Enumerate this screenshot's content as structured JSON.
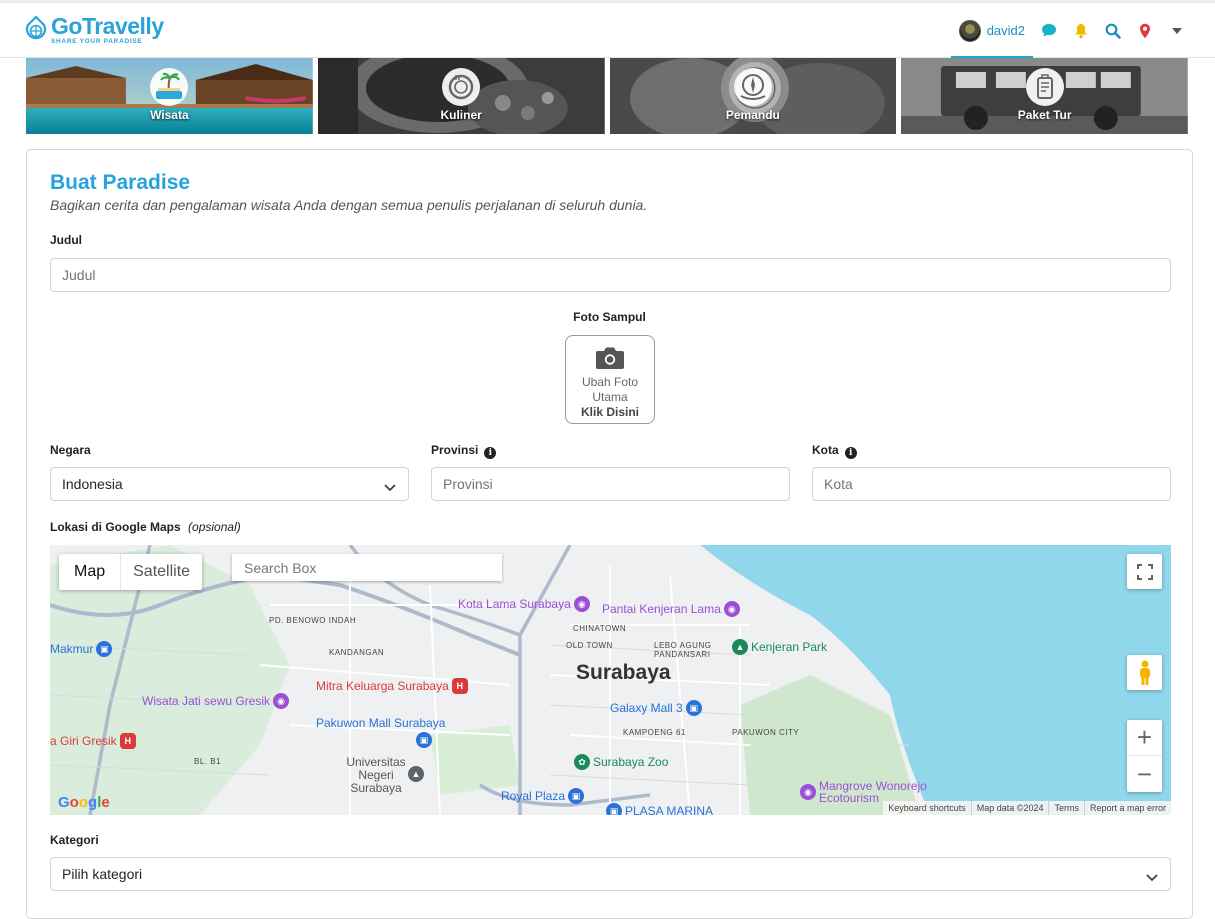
{
  "brand": {
    "name": "GoTravelly",
    "tagline": "SHARE YOUR PARADISE"
  },
  "nav": {
    "username": "david2",
    "icons": [
      "chat-icon",
      "bell-icon",
      "search-icon",
      "location-pin-icon",
      "caret-down-icon"
    ],
    "colors": {
      "chat": "#1bb0c9",
      "bell": "#f5b800",
      "search": "#1a8ec4",
      "pin": "#e0393e"
    }
  },
  "categories": [
    {
      "label": "Wisata",
      "icon": "beach-icon"
    },
    {
      "label": "Kuliner",
      "icon": "food-icon"
    },
    {
      "label": "Pemandu",
      "icon": "guide-icon"
    },
    {
      "label": "Paket Tur",
      "icon": "tour-package-icon"
    }
  ],
  "form": {
    "title": "Buat Paradise",
    "subtitle": "Bagikan cerita dan pengalaman wisata Anda dengan semua penulis perjalanan di seluruh dunia.",
    "judul_label": "Judul",
    "judul_placeholder": "Judul",
    "photo_label": "Foto Sampul",
    "photo_text_1": "Ubah Foto",
    "photo_text_2": "Utama",
    "photo_cta": "Klik Disini",
    "negara_label": "Negara",
    "negara_value": "Indonesia",
    "provinsi_label": "Provinsi",
    "provinsi_placeholder": "Provinsi",
    "kota_label": "Kota",
    "kota_placeholder": "Kota",
    "maps_label": "Lokasi di Google Maps",
    "maps_optional": "(opsional)",
    "kategori_label": "Kategori",
    "kategori_value": "Pilih kategori"
  },
  "map": {
    "type_map": "Map",
    "type_satellite": "Satellite",
    "search_placeholder": "Search Box",
    "city": "Surabaya",
    "logo": "Google",
    "footer": [
      "Keyboard shortcuts",
      "Map data ©2024",
      "Terms",
      "Report a map error"
    ],
    "districts": [
      "PD. BENOWO INDAH",
      "KANDANGAN",
      "CHINATOWN",
      "OLD TOWN",
      "LEBO AGUNG PANDANSARI",
      "KAMPOENG 61",
      "PAKUWON CITY",
      "BL. B1"
    ],
    "pois": [
      {
        "name": "Kota Lama Surabaya",
        "color": "#9c4fd6"
      },
      {
        "name": "Pantai Kenjeran Lama",
        "color": "#9c4fd6"
      },
      {
        "name": "Kenjeran Park",
        "color": "#1a8a5a"
      },
      {
        "name": "Mitra Keluarga Surabaya",
        "color": "#d93b3b"
      },
      {
        "name": "Wisata Jati sewu Gresik",
        "color": "#9c4fd6"
      },
      {
        "name": "Pakuwon Mall Surabaya",
        "color": "#2a72d8"
      },
      {
        "name": "Galaxy Mall 3",
        "color": "#2a72d8"
      },
      {
        "name": "Surabaya Zoo",
        "color": "#1a8a5a"
      },
      {
        "name": "Universitas Negeri Surabaya",
        "color": "#5f6368"
      },
      {
        "name": "Royal Plaza",
        "color": "#2a72d8"
      },
      {
        "name": "PLASA MARINA",
        "color": "#2a72d8"
      },
      {
        "name": "Mangrove Wonorejo Ecotourism",
        "color": "#9c4fd6"
      },
      {
        "name": "Makmur",
        "color": "#2a72d8"
      },
      {
        "name": "a Giri Gresik",
        "color": "#d93b3b"
      }
    ]
  }
}
